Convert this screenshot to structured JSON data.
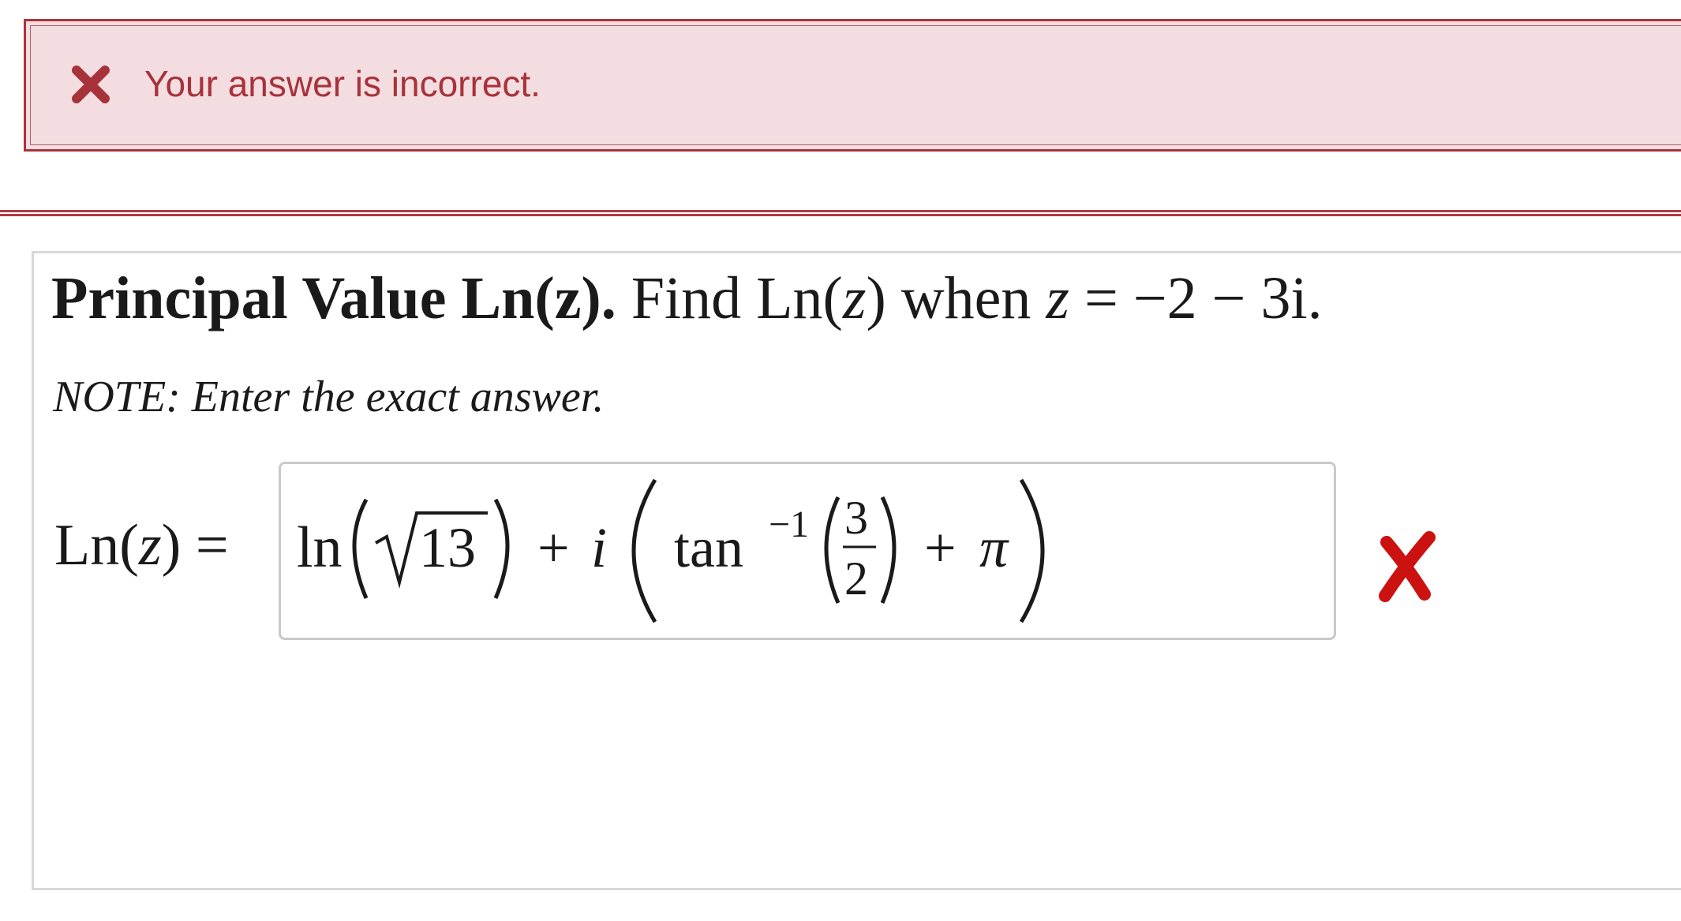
{
  "feedback": {
    "icon": "x-icon",
    "message": "Your answer is incorrect.",
    "color": "#a8323a",
    "background": "#f3dde1"
  },
  "question": {
    "title_bold": "Principal Value Ln(z).",
    "title_rest_prefix": " Find Ln(",
    "title_var": "z",
    "title_rest_mid": ") when ",
    "title_var2": "z",
    "title_rest_suffix": " = −2 − 3i.",
    "note": "NOTE: Enter the exact answer."
  },
  "answer": {
    "label_prefix": "Ln(",
    "label_var": "z",
    "label_suffix": ") =",
    "entered": {
      "ln": "ln",
      "sqrt_arg": "13",
      "plus1": "+",
      "i": "i",
      "tan": "tan",
      "exp": "−1",
      "num": "3",
      "den": "2",
      "plus2": "+",
      "pi": "π"
    },
    "status_icon": "red-x-icon",
    "status_color": "#cc1111"
  }
}
